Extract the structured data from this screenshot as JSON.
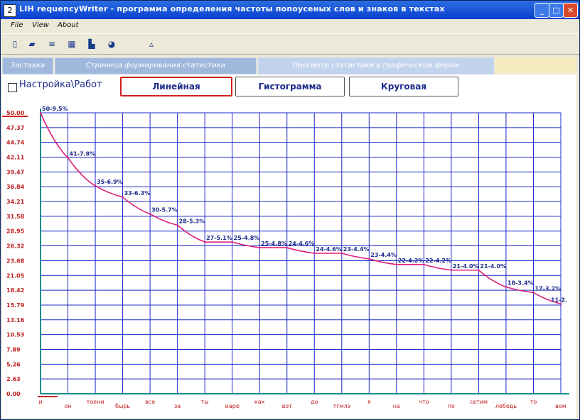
{
  "window": {
    "title": "LIH requencyWriter - программа определения частоты попоусеных слов и знаков в текстах",
    "icon_label": "2",
    "controls": {
      "minimize": "_",
      "maximize": "□",
      "close": "✕"
    }
  },
  "menu": {
    "items": [
      "File",
      "View",
      "About"
    ]
  },
  "toolbar": {
    "tools": [
      {
        "icon": "open-file-icon",
        "glyph": "▯"
      },
      {
        "icon": "save-icon",
        "glyph": "▰"
      },
      {
        "icon": "text-lines-icon",
        "glyph": "≡"
      },
      {
        "icon": "table-grid-icon",
        "glyph": "▦"
      },
      {
        "icon": "bar-chart-icon",
        "glyph": "▙"
      },
      {
        "icon": "pie-chart-icon",
        "glyph": "◕"
      },
      {
        "icon": "info-icon",
        "glyph": "▵"
      }
    ]
  },
  "tabs": [
    {
      "label": "Заставка"
    },
    {
      "label": "Страница формирования статистики"
    },
    {
      "label": "Просмотр статистики в графическом форме"
    }
  ],
  "settings": {
    "checkbox_label": "Настройка\\Работ",
    "checked": false
  },
  "chart_buttons": {
    "line": "Линейная",
    "histogram": "Гистограмма",
    "pie": "Круговая"
  },
  "colors": {
    "grid": "#1c28c8",
    "line": "#e0207a",
    "tick": "#c02020",
    "accent": "#d02020"
  },
  "chart_data": {
    "type": "line",
    "yticks": [
      "0.00",
      "2.63",
      "5.26",
      "7.89",
      "10.53",
      "13.16",
      "15.79",
      "18.42",
      "21.05",
      "23.68",
      "26.32",
      "28.95",
      "31.58",
      "34.21",
      "36.84",
      "39.47",
      "42.11",
      "44.74",
      "47.37",
      "50.00"
    ],
    "ylim": [
      0,
      50
    ],
    "categories": [
      "и",
      "он",
      "тоени",
      "бырь",
      "все",
      "за",
      "ты",
      "иаре",
      "как",
      "вот",
      "до",
      "тгмлэ",
      "я",
      "на",
      "что",
      "по",
      "сетим",
      "лебедь",
      "то",
      "вом"
    ],
    "values": [
      50,
      42,
      37,
      35,
      32,
      30,
      27,
      27,
      26,
      26,
      25,
      25,
      24,
      23,
      23,
      22,
      22,
      19,
      18,
      16
    ],
    "point_labels": [
      "50-9.5%",
      "41-7.8%",
      "35-6.9%",
      "33-6.3%",
      "30-5.7%",
      "28-5.3%",
      "27-5.1%",
      "25-4.8%",
      "25-4.8%",
      "24-4.6%",
      "24-4.6%",
      "23-4.4%",
      "23-4.4%",
      "22-4.2%",
      "22-4.2%",
      "21-4.0%",
      "21-4.0%",
      "18-3.4%",
      "17-3.2%",
      "11-2."
    ]
  }
}
